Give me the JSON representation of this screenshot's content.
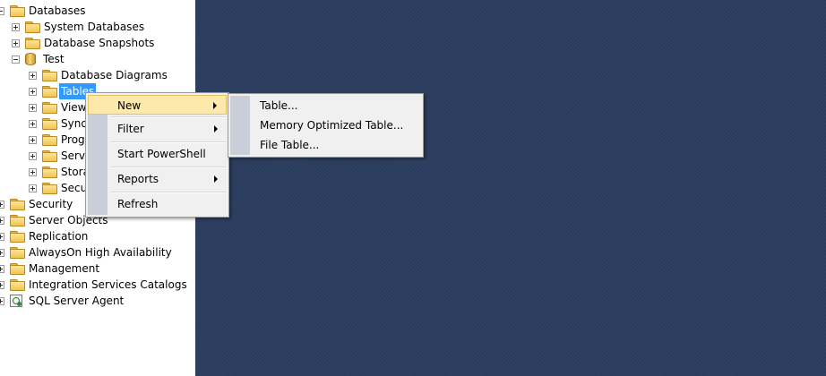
{
  "tree": {
    "databases": "Databases",
    "system_databases": "System Databases",
    "database_snapshots": "Database Snapshots",
    "test": "Test",
    "database_diagrams": "Database Diagrams",
    "tables": "Tables",
    "views": "Views",
    "synonyms": "Syno",
    "programmability": "Progr",
    "service_broker": "Servic",
    "storage": "Stora",
    "security_db": "Secur",
    "security": "Security",
    "server_objects": "Server Objects",
    "replication": "Replication",
    "alwayson": "AlwaysOn High Availability",
    "management": "Management",
    "integration_services": "Integration Services Catalogs",
    "sql_server_agent": "SQL Server Agent"
  },
  "context_menu": {
    "new": "New",
    "filter": "Filter",
    "start_powershell": "Start PowerShell",
    "reports": "Reports",
    "refresh": "Refresh"
  },
  "submenu_new": {
    "table": "Table...",
    "memory_optimized_table": "Memory Optimized Table...",
    "file_table": "File Table..."
  },
  "colors": {
    "workspace": "#2c3e60",
    "menu_background": "#f0f0f0",
    "menu_gutter": "#c9cfd9",
    "menu_highlight": "#fde9ac",
    "selection": "#3399ff"
  }
}
